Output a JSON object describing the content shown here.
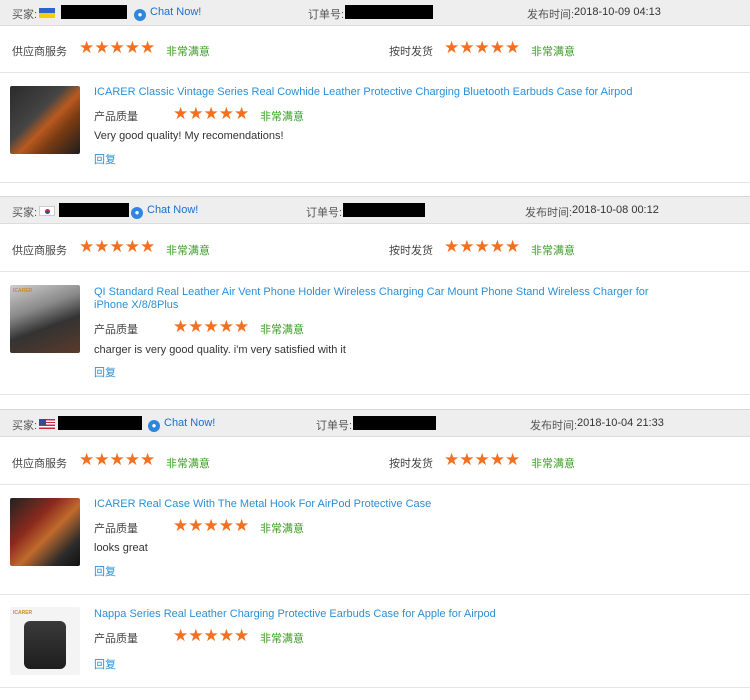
{
  "labels": {
    "buyer": "买家:",
    "order_no": "订单号:",
    "publish_time": "发布时间:",
    "supplier_service": "供应商服务",
    "on_time_shipping": "按时发货",
    "product_quality": "产品质量",
    "very_satisfied": "非常满意",
    "reply": "回复",
    "chat_now": "Chat Now!",
    "stars": "★★★★★"
  },
  "reviews": [
    {
      "flag": "ukraine-flag",
      "time": "2018-10-09 04:13",
      "supplier_rating": 5,
      "shipping_rating": 5,
      "items": [
        {
          "brand": "",
          "title": "ICARER Classic Vintage Series Real Cowhide Leather Protective Charging Bluetooth Earbuds Case for Airpod",
          "quality_rating": 5,
          "comment": "Very good quality! My recomendations!"
        }
      ]
    },
    {
      "flag": "south-korea-flag",
      "time": "2018-10-08 00:12",
      "supplier_rating": 5,
      "shipping_rating": 5,
      "items": [
        {
          "brand": "ICARER",
          "title": "QI Standard Real Leather Air Vent Phone Holder Wireless Charging Car Mount Phone Stand Wireless Charger for iPhone X/8/8Plus",
          "quality_rating": 5,
          "comment": "charger is very good quality. i'm very satisfied with it"
        }
      ]
    },
    {
      "flag": "usa-flag",
      "time": "2018-10-04 21:33",
      "supplier_rating": 5,
      "shipping_rating": 5,
      "items": [
        {
          "brand": "",
          "title": "ICARER Real Case With The Metal Hook For AirPod Protective Case",
          "quality_rating": 5,
          "comment": "looks great"
        },
        {
          "brand": "ICARER",
          "title": "Nappa Series Real Leather Charging Protective Earbuds Case for Apple for Airpod",
          "quality_rating": 5,
          "comment": ""
        }
      ]
    }
  ]
}
